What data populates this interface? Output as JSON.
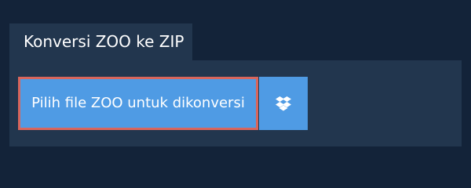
{
  "tab": {
    "title": "Konversi ZOO ke ZIP"
  },
  "upload": {
    "choose_file_label": "Pilih file ZOO untuk dikonversi",
    "dropbox_icon": "dropbox-icon"
  },
  "colors": {
    "page_background": "#132339",
    "panel_background": "#22364e",
    "button_blue": "#4f9be4",
    "focus_border": "#d8665d",
    "text": "#ffffff"
  }
}
